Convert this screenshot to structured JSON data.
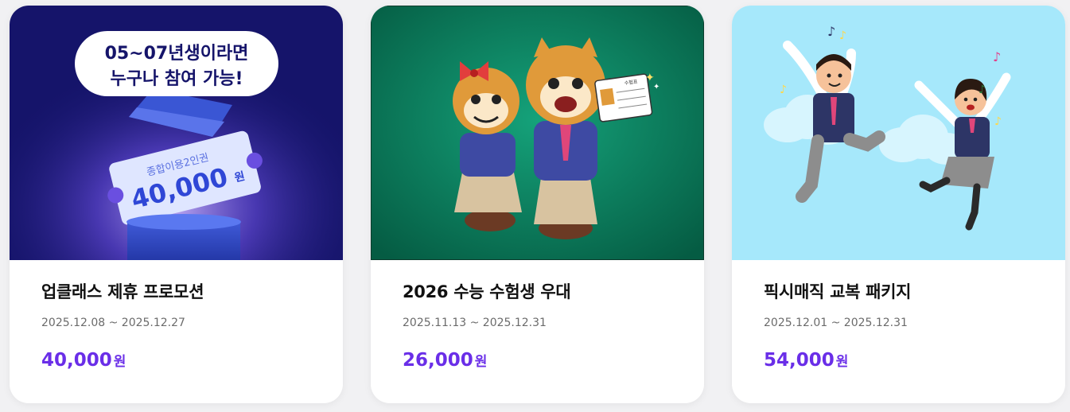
{
  "cards": [
    {
      "title": "업클래스 제휴 프로모션",
      "period": "2025.12.08 ~ 2025.12.27",
      "price": "40,000",
      "currency": "원",
      "banner": {
        "bubble_line1": "05~07년생이라면",
        "bubble_line2": "누구나 참여 가능!",
        "ticket_caption": "종합이용2인권",
        "ticket_amount": "40,000",
        "ticket_unit": "원"
      },
      "bg_color": "#15146a"
    },
    {
      "title": "2026 수능 수험생 우대",
      "period": "2025.11.13 ~ 2025.12.31",
      "price": "26,000",
      "currency": "원",
      "banner": {
        "card_label": "수험표"
      },
      "bg_color": "#0a7a5c"
    },
    {
      "title": "픽시매직 교복 패키지",
      "period": "2025.12.01 ~ 2025.12.31",
      "price": "54,000",
      "currency": "원",
      "bg_color": "#a6e8fb"
    }
  ],
  "accent_color": "#6a2ee8"
}
